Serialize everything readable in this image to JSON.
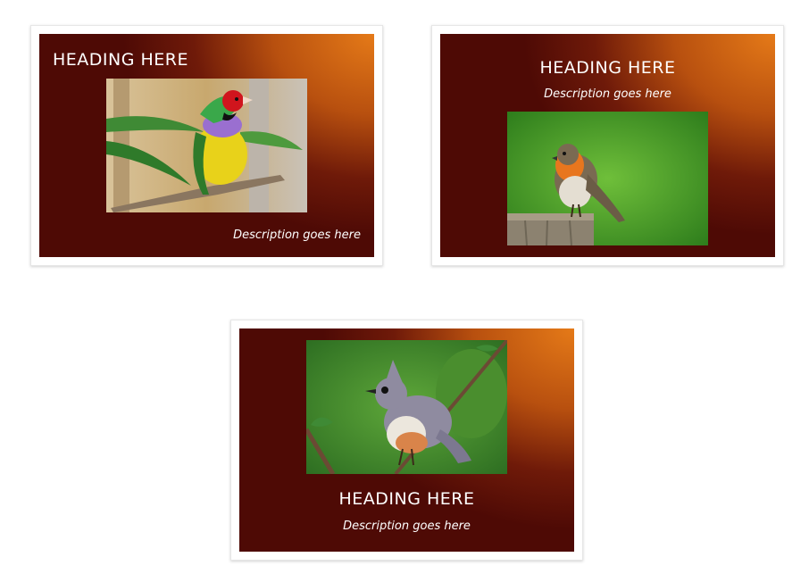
{
  "cards": [
    {
      "heading": "HEADING HERE",
      "description": "Description goes here",
      "image_subject": "gouldian-finch-photo"
    },
    {
      "heading": "HEADING HERE",
      "description": "Description goes here",
      "image_subject": "robin-photo"
    },
    {
      "heading": "HEADING HERE",
      "description": "Description goes here",
      "image_subject": "titmouse-photo"
    }
  ],
  "colors": {
    "page_background": "#ffffff",
    "card_gradient_light": "#e57a18",
    "card_gradient_dark": "#4e0a05",
    "text": "#ffffff"
  }
}
